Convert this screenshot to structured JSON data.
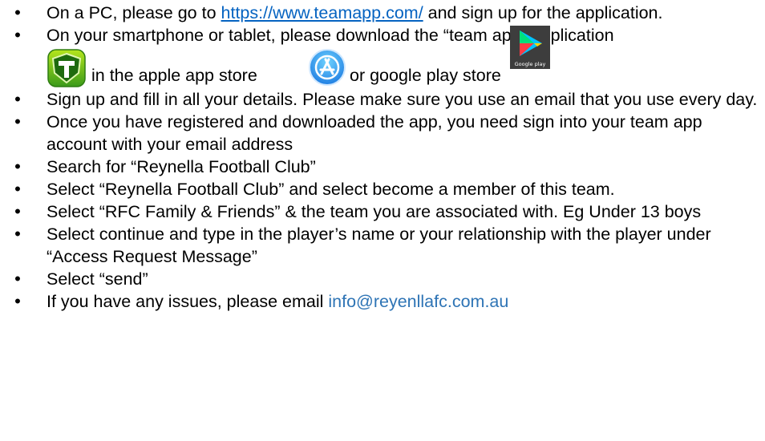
{
  "steps": [
    {
      "before": "On a PC, please go to ",
      "link": "https://www.teamapp.com/",
      "after": " and sign up for the application."
    },
    {
      "line1": "On your smartphone or tablet, please download the “team app” application",
      "seg1": " in the apple app store ",
      "seg2": " or google play store",
      "icons": [
        "team-app-icon",
        "apple-app-store-icon",
        "google-play-store-icon"
      ],
      "icon_caption": "Google play"
    },
    {
      "text": "Sign up and fill in all your details. Please make sure you use an email that you use every day."
    },
    {
      "text": "Once you have registered and downloaded the app, you need sign into your team app account with your email address"
    },
    {
      "text": "Search for “Reynella Football Club”"
    },
    {
      "text": "Select “Reynella Football Club” and select become a member of this team."
    },
    {
      "text": "Select “RFC Family & Friends” & the team you are associated with. Eg Under 13 boys"
    },
    {
      "text": "Select continue and type in the player’s name or your relationship with the player under “Access Request Message”"
    },
    {
      "text": "Select “send”"
    },
    {
      "before": "If you have any issues, please email ",
      "email": "info@reyenllafc.com.au"
    }
  ],
  "bullet": "•",
  "colors": {
    "link": "#0563c1",
    "email": "#2e74b5"
  }
}
